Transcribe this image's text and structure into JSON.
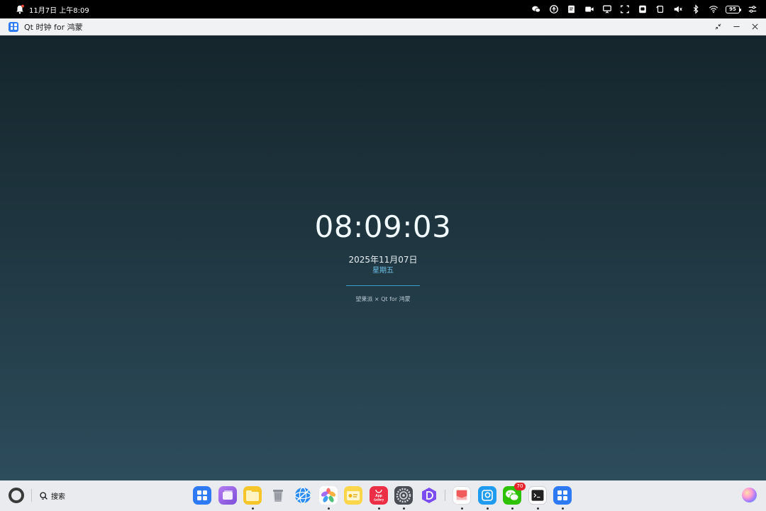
{
  "status_bar": {
    "datetime": "11月7日 上午8:09",
    "battery_level": "95",
    "icons": [
      "bell-alert-icon",
      "wechat-icon",
      "accessibility-icon",
      "notes-icon",
      "video-icon",
      "screen-cast-icon",
      "screenshot-icon",
      "tablet-icon",
      "rotation-icon",
      "mute-icon",
      "bluetooth-icon",
      "wifi-icon",
      "battery-icon",
      "controls-icon"
    ]
  },
  "window": {
    "title": "Qt 时钟 for 鸿蒙",
    "controls": [
      "restore-icon",
      "minimize-icon",
      "close-icon"
    ]
  },
  "clock": {
    "time": "08:09:03",
    "date": "2025年11月07日",
    "weekday": "星期五",
    "credit": "望果派 × Qt for 鸿蒙",
    "accent_color": "#3b9ec9"
  },
  "dock": {
    "search_label": "搜索",
    "apps": [
      {
        "name": "app-center",
        "running": false
      },
      {
        "name": "multi-window",
        "running": false
      },
      {
        "name": "files",
        "running": true
      },
      {
        "name": "trash",
        "running": false
      },
      {
        "name": "browser",
        "running": false
      },
      {
        "name": "gallery",
        "running": true
      },
      {
        "name": "memo",
        "running": false
      },
      {
        "name": "app-gallery",
        "running": true,
        "label": "App Gallery"
      },
      {
        "name": "settings",
        "running": true
      },
      {
        "name": "devtools",
        "running": false
      },
      {
        "name": "notes",
        "running": true
      },
      {
        "name": "filemanager",
        "running": true
      },
      {
        "name": "wechat",
        "running": true,
        "badge": "70"
      },
      {
        "name": "terminal",
        "running": true
      },
      {
        "name": "qt-clock",
        "running": true
      }
    ]
  }
}
